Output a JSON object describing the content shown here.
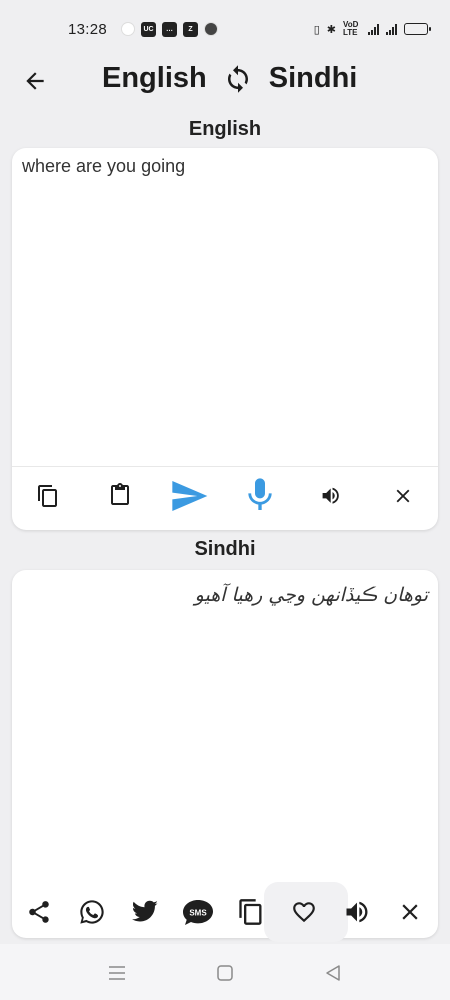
{
  "status_bar": {
    "time": "13:28",
    "network_label": "VoD LTE",
    "battery_level": 0.85
  },
  "header": {
    "source_language": "English",
    "target_language": "Sindhi",
    "back_icon": "arrow-left-icon",
    "swap_icon": "sync-icon"
  },
  "input_section": {
    "label": "English",
    "text": "where are you going",
    "actions": [
      "copy-icon",
      "paste-icon",
      "send-icon",
      "mic-icon",
      "speaker-icon",
      "close-icon"
    ]
  },
  "output_section": {
    "label": "Sindhi",
    "text": "توهان ڪيڏانهن وڃي رهيا آهيو",
    "actions": [
      "share-icon",
      "whatsapp-icon",
      "twitter-icon",
      "sms-icon",
      "copy-icon",
      "heart-icon",
      "speaker-icon",
      "close-icon"
    ]
  },
  "colors": {
    "accent": "#3b9ae1",
    "background": "#efeff1",
    "card": "#ffffff",
    "icon": "#1f1f1f"
  },
  "nav_bar": {
    "buttons": [
      "menu-icon",
      "home-icon",
      "back-icon"
    ]
  }
}
